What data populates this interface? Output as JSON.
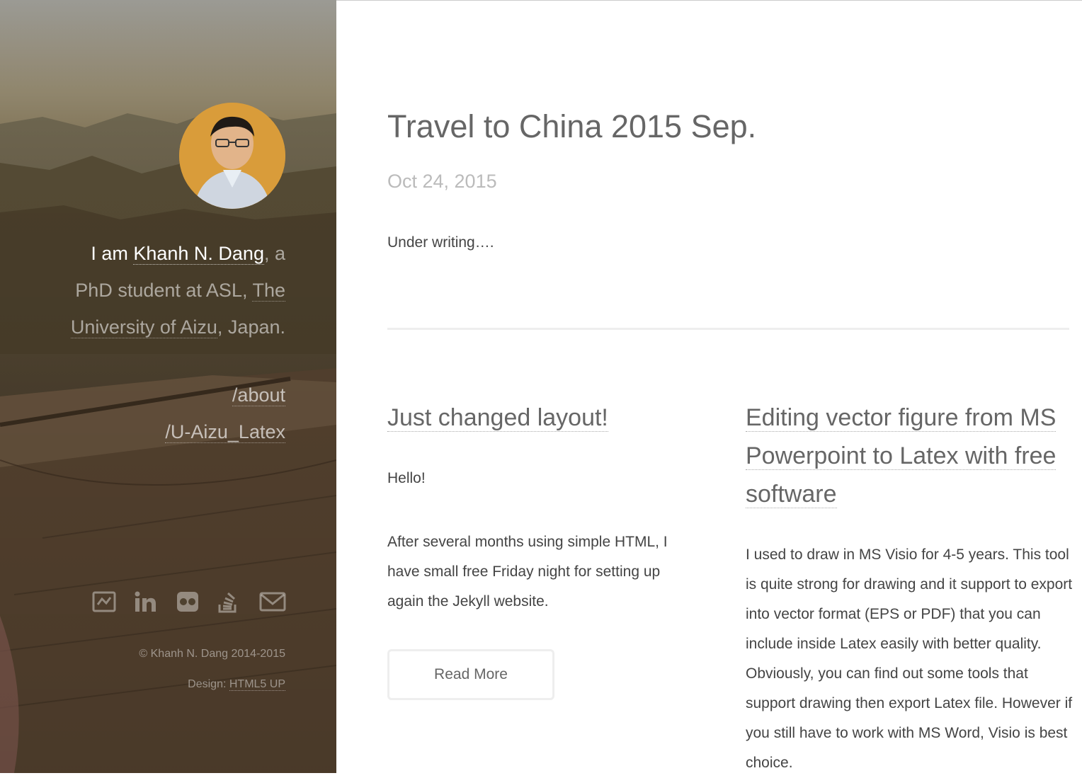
{
  "sidebar": {
    "intro_prefix": "I am ",
    "name_link": "Khanh N. Dang",
    "intro_mid": ", a PhD student at ASL, ",
    "university_link": "The University of Aizu",
    "intro_suffix": ", Japan.",
    "nav": [
      "/about",
      "/U-Aizu_Latex"
    ],
    "social_icons": [
      "deviantart-icon",
      "linkedin-icon",
      "flickr-icon",
      "stackoverflow-icon",
      "email-icon"
    ],
    "copyright": "© Khanh N. Dang 2014-2015",
    "design_prefix": "Design: ",
    "design_link": "HTML5 UP"
  },
  "featured": {
    "title": "Travel to China 2015 Sep.",
    "date": "Oct 24, 2015",
    "body": "Under writing…."
  },
  "posts": [
    {
      "title": "Just changed layout!",
      "paragraphs": [
        "Hello!",
        "After several months using simple HTML, I have small free Friday night for setting up again the Jekyll website."
      ],
      "read_more": "Read More"
    },
    {
      "title": "Editing vector figure from MS Powerpoint to Latex with free software",
      "paragraphs": [
        "I used to draw in MS Visio for 4-5 years. This tool is quite strong for drawing and it support to export into vector format (EPS or PDF) that you can include inside Latex easily with better quality. Obviously, you can find out some tools that support drawing then export Latex file. However if you still have to work with MS Word, Visio is best choice."
      ]
    }
  ]
}
